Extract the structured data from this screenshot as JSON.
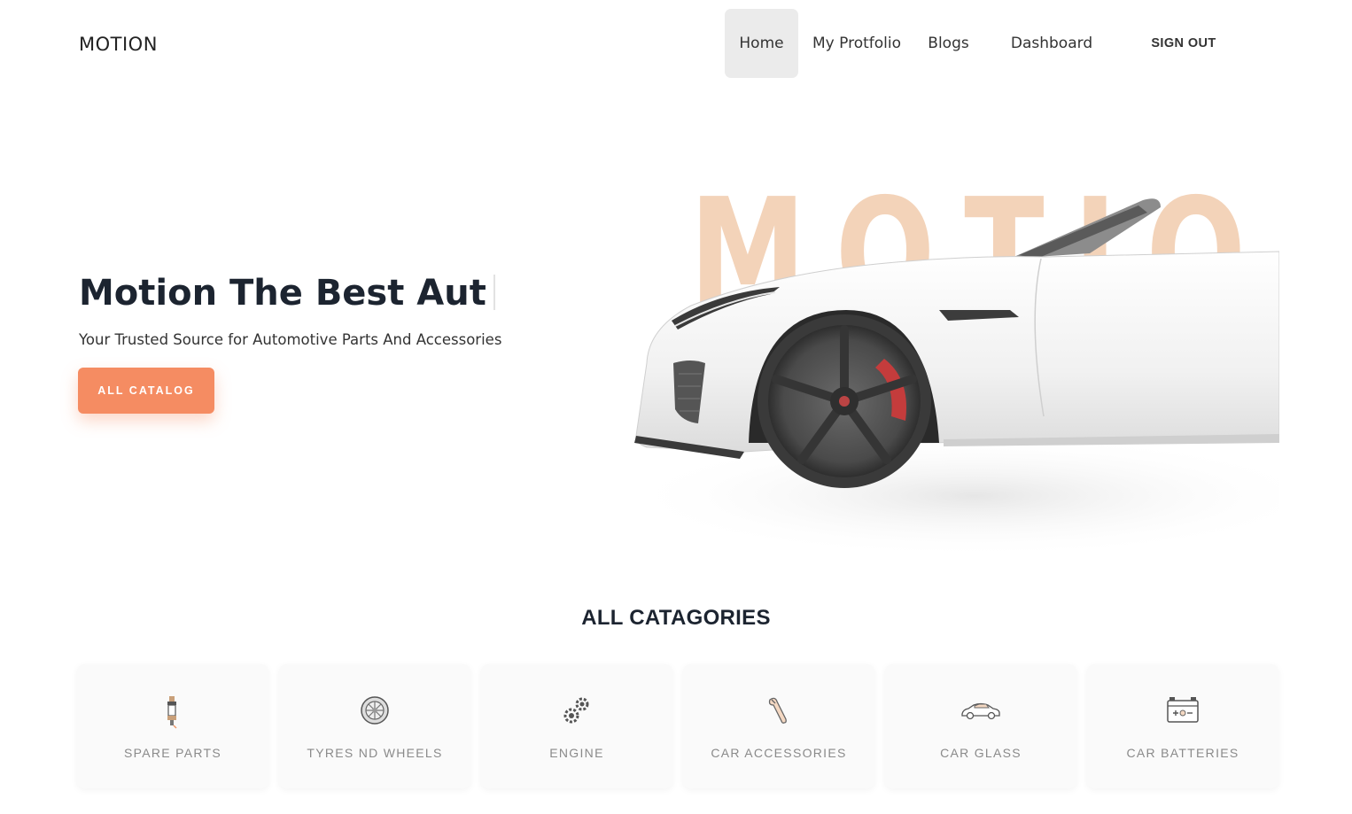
{
  "brand": {
    "logo": "MOTION"
  },
  "nav": {
    "items": [
      {
        "label": "Home",
        "active": true
      },
      {
        "label": "My Protfolio"
      },
      {
        "label": "Blogs"
      },
      {
        "label": "Dashboard"
      }
    ],
    "signout": "SIGN OUT"
  },
  "hero": {
    "title": "Motion The Best Aut",
    "subtitle": "Your Trusted Source for Automotive Parts And Accessories",
    "cta": "ALL CATALOG",
    "background_word": "MOTIO"
  },
  "categories": {
    "title": "ALL CATAGORIES",
    "items": [
      {
        "label": "SPARE PARTS",
        "icon": "spark-plug-icon"
      },
      {
        "label": "TYRES ND WHEELS",
        "icon": "tyre-icon"
      },
      {
        "label": "ENGINE",
        "icon": "gears-icon"
      },
      {
        "label": "CAR ACCESSORIES",
        "icon": "wrench-icon"
      },
      {
        "label": "CAR GLASS",
        "icon": "car-icon"
      },
      {
        "label": "CAR BATTERIES",
        "icon": "battery-icon"
      }
    ]
  },
  "colors": {
    "accent": "#f58c62",
    "bg_word": "#f3d3b9",
    "active_nav": "#ebebeb"
  }
}
